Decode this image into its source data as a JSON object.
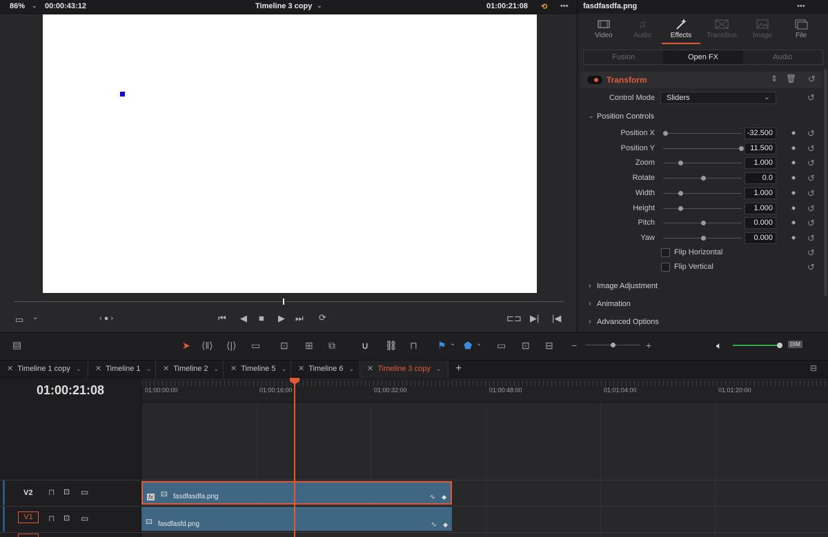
{
  "viewer": {
    "zoom": "86%",
    "duration_tc": "00:00:43:12",
    "timeline_name": "Timeline 3 copy",
    "current_tc": "01:00:21:08"
  },
  "inspector": {
    "clip_name": "fasdfasdfa.png",
    "tabs": [
      {
        "label": "Video",
        "icon": "video-icon",
        "state": "normal"
      },
      {
        "label": "Audio",
        "icon": "music-note-icon",
        "state": "dim"
      },
      {
        "label": "Effects",
        "icon": "magic-wand-icon",
        "state": "active"
      },
      {
        "label": "Transition",
        "icon": "transition-icon",
        "state": "dim"
      },
      {
        "label": "Image",
        "icon": "image-icon",
        "state": "dim"
      },
      {
        "label": "File",
        "icon": "file-icon",
        "state": "normal"
      }
    ],
    "subtabs": [
      "Fusion",
      "Open FX",
      "Audio"
    ],
    "transform_title": "Transform",
    "control_mode_label": "Control Mode",
    "control_mode_value": "Sliders",
    "position_controls_label": "Position Controls",
    "params": [
      {
        "label": "Position X",
        "value": "-32.500",
        "knob": 0.0
      },
      {
        "label": "Position Y",
        "value": "11.500",
        "knob": 1.0
      },
      {
        "label": "Zoom",
        "value": "1.000",
        "knob": 0.2
      },
      {
        "label": "Rotate",
        "value": "0.0",
        "knob": 0.5
      },
      {
        "label": "Width",
        "value": "1.000",
        "knob": 0.2
      },
      {
        "label": "Height",
        "value": "1.000",
        "knob": 0.2
      },
      {
        "label": "Pitch",
        "value": "0.000",
        "knob": 0.5
      },
      {
        "label": "Yaw",
        "value": "0.000",
        "knob": 0.5
      }
    ],
    "flip_horizontal": "Flip Horizontal",
    "flip_vertical": "Flip Vertical",
    "sections": [
      "Image Adjustment",
      "Animation",
      "Advanced Options"
    ]
  },
  "timeline_tabs": [
    {
      "label": "Timeline 1 copy",
      "active": false
    },
    {
      "label": "Timeline 1",
      "active": false
    },
    {
      "label": "Timeline 2",
      "active": false
    },
    {
      "label": "Timeline 5",
      "active": false
    },
    {
      "label": "Timeline 6",
      "active": false
    },
    {
      "label": "Timeline 3 copy",
      "active": true
    }
  ],
  "timeline": {
    "timecode": "01:00:21:08",
    "ruler_labels": [
      "01:00:00:00",
      "01:00:16:00",
      "01:00:32:00",
      "01:00:48:00",
      "01:01:04:00",
      "01:01:20:00"
    ],
    "tracks": [
      {
        "name": "V2",
        "clip": "fasdfasdfa.png",
        "selected": true
      },
      {
        "name": "V1",
        "clip": "fasdfasfd.png",
        "selected": false
      }
    ],
    "audio_dim_label": "DIM"
  },
  "colors": {
    "accent": "#e05a3a",
    "clip": "#3f6783",
    "blue_marker": "#0a0adf",
    "audio_meter": "#2ea84a"
  }
}
